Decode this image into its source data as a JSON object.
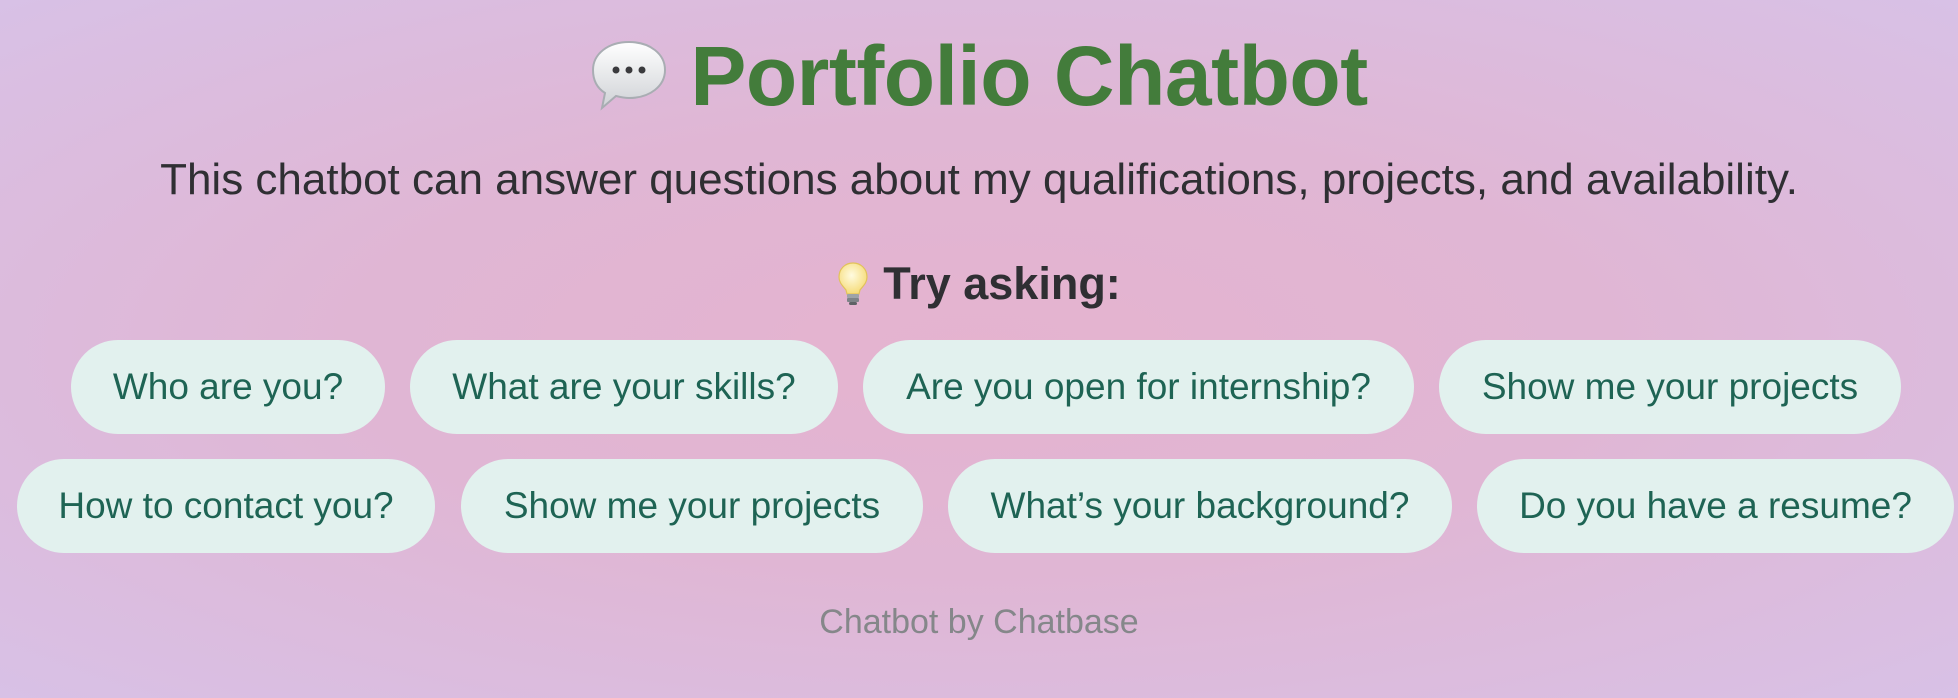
{
  "header": {
    "title": "Portfolio Chatbot",
    "title_icon": "speech-bubble-icon",
    "subtitle": "This chatbot can answer questions about my qualifications, projects, and availability."
  },
  "suggestions": {
    "heading": "Try asking:",
    "heading_icon": "lightbulb-icon",
    "chips": [
      "Who are you?",
      "What are your skills?",
      "Are you open for internship?",
      "Show me your projects",
      "How to contact you?",
      "Show me your projects",
      "What’s your background?",
      "Do you have a resume?"
    ]
  },
  "footer": {
    "text": "Chatbot by Chatbase"
  },
  "colors": {
    "title": "#437c3b",
    "chip_background": "#e2f1ee",
    "chip_text": "#1e6454",
    "body_text": "#2f2f33",
    "footer_text": "#85878a"
  }
}
